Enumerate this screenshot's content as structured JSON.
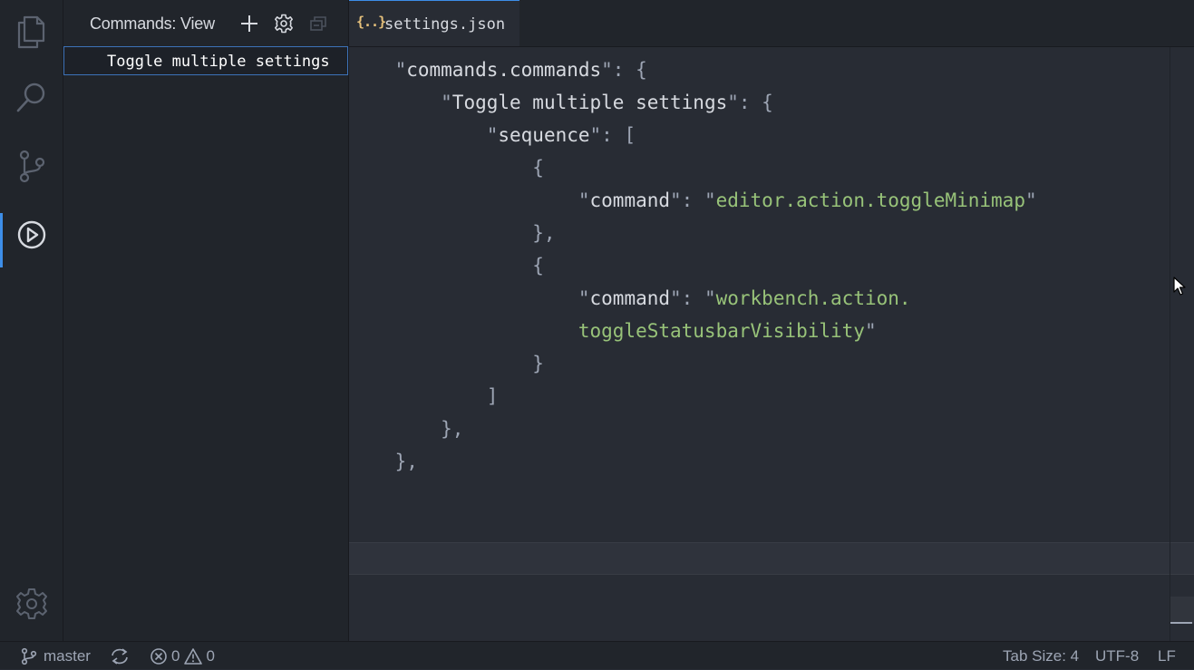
{
  "sidebar": {
    "title": "Commands: View",
    "tree_items": [
      {
        "label": "Toggle multiple settings"
      }
    ]
  },
  "tabs": [
    {
      "icon_text": "{..}",
      "label": "settings.json",
      "active": true
    }
  ],
  "editor": {
    "lines": [
      [
        {
          "c": "p",
          "t": "    \""
        },
        {
          "c": "k",
          "t": "commands.commands"
        },
        {
          "c": "p",
          "t": "\": {"
        }
      ],
      [
        {
          "c": "p",
          "t": "        \""
        },
        {
          "c": "k",
          "t": "Toggle multiple settings"
        },
        {
          "c": "p",
          "t": "\": {"
        }
      ],
      [
        {
          "c": "p",
          "t": "            \""
        },
        {
          "c": "k",
          "t": "sequence"
        },
        {
          "c": "p",
          "t": "\": ["
        }
      ],
      [
        {
          "c": "p",
          "t": "                {"
        }
      ],
      [
        {
          "c": "p",
          "t": "                    \""
        },
        {
          "c": "k",
          "t": "command"
        },
        {
          "c": "p",
          "t": "\": \""
        },
        {
          "c": "s",
          "t": "editor.action.toggleMinimap"
        },
        {
          "c": "p",
          "t": "\""
        }
      ],
      [
        {
          "c": "p",
          "t": "                },"
        }
      ],
      [
        {
          "c": "p",
          "t": "                {"
        }
      ],
      [
        {
          "c": "p",
          "t": "                    \""
        },
        {
          "c": "k",
          "t": "command"
        },
        {
          "c": "p",
          "t": "\": \""
        },
        {
          "c": "s",
          "t": "workbench.action."
        }
      ],
      [
        {
          "c": "s",
          "t": "                    toggleStatusbarVisibility"
        },
        {
          "c": "p",
          "t": "\""
        }
      ],
      [
        {
          "c": "p",
          "t": "                }"
        }
      ],
      [
        {
          "c": "p",
          "t": "            ]"
        }
      ],
      [
        {
          "c": "p",
          "t": "        },"
        }
      ],
      [
        {
          "c": "p",
          "t": "    },"
        }
      ]
    ]
  },
  "statusbar": {
    "branch": "master",
    "errors": "0",
    "warnings": "0",
    "tab_size": "Tab Size: 4",
    "encoding": "UTF-8",
    "eol": "LF"
  },
  "colors": {
    "accent": "#3d8ee8",
    "string": "#98c379",
    "json_icon": "#e5c07b",
    "background": "#282c34",
    "chrome": "#21252b"
  },
  "icons": [
    "files-icon",
    "search-icon",
    "source-control-icon",
    "run-icon",
    "settings-gear-icon",
    "add-icon",
    "gear-icon",
    "collapse-all-icon",
    "json-file-icon",
    "git-branch-icon",
    "sync-icon",
    "error-icon",
    "warning-icon",
    "mouse-pointer-icon"
  ]
}
